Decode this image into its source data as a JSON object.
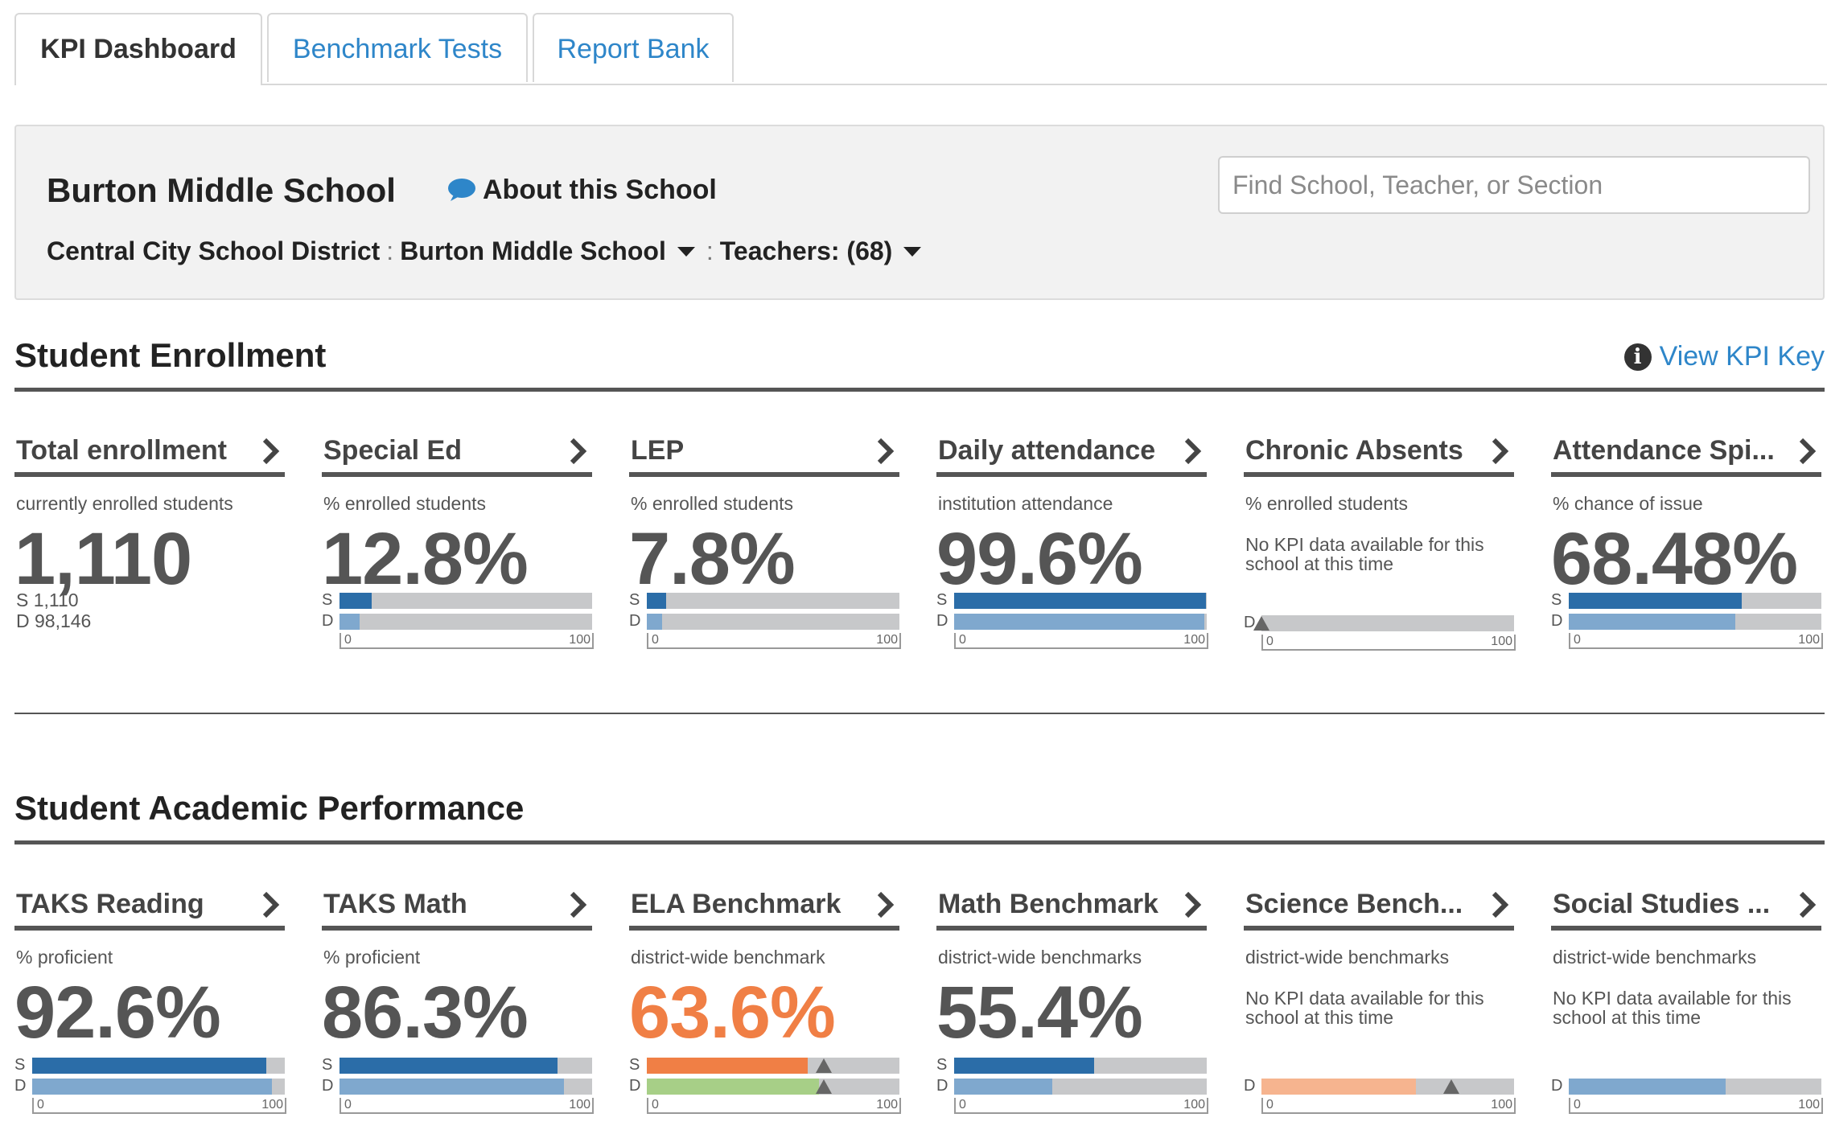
{
  "tabs": [
    "KPI Dashboard",
    "Benchmark Tests",
    "Report Bank"
  ],
  "header": {
    "school_name": "Burton Middle School",
    "about_link": "About this School",
    "breadcrumb": {
      "district": "Central City School District",
      "separator": ":",
      "school": "Burton Middle School",
      "teachers": "Teachers: (68)"
    },
    "search_placeholder": "Find School, Teacher, or Section"
  },
  "enrollment": {
    "title": "Student Enrollment",
    "kpi_key_link": "View KPI Key",
    "cards": [
      {
        "title": "Total enrollment",
        "subtitle": "currently enrolled students",
        "value": "1,110",
        "s_line": "S 1,110",
        "d_line": "D 98,146"
      },
      {
        "title": "Special Ed",
        "subtitle": "% enrolled students",
        "value": "12.8%",
        "s_pct": 12.8,
        "d_pct": 8
      },
      {
        "title": "LEP",
        "subtitle": "% enrolled students",
        "value": "7.8%",
        "s_pct": 7.8,
        "d_pct": 6
      },
      {
        "title": "Daily attendance",
        "subtitle": "institution attendance",
        "value": "99.6%",
        "s_pct": 99.6,
        "d_pct": 99
      },
      {
        "title": "Chronic Absents",
        "subtitle": "% enrolled students",
        "nodata": "No KPI data available for this school at this time"
      },
      {
        "title": "Attendance Spi...",
        "subtitle": "% chance of issue",
        "value": "68.48%",
        "s_pct": 68.5,
        "d_pct": 66
      }
    ]
  },
  "academic": {
    "title": "Student Academic Performance",
    "cards": [
      {
        "title": "TAKS Reading",
        "subtitle": "% proficient",
        "value": "92.6%",
        "s_pct": 92.6,
        "d_pct": 95
      },
      {
        "title": "TAKS Math",
        "subtitle": "% proficient",
        "value": "86.3%",
        "s_pct": 86.3,
        "d_pct": 89
      },
      {
        "title": "ELA Benchmark",
        "subtitle": "district-wide benchmark",
        "value": "63.6%",
        "s_pct": 63.6,
        "d_pct": 68,
        "target_pct": 70
      },
      {
        "title": "Math Benchmark",
        "subtitle": "district-wide benchmarks",
        "value": "55.4%",
        "s_pct": 55.4,
        "d_pct": 39
      },
      {
        "title": "Science Bench...",
        "subtitle": "district-wide benchmarks",
        "nodata": "No KPI data available for this school at this time",
        "d_pct": 61,
        "target_pct": 75
      },
      {
        "title": "Social Studies ...",
        "subtitle": "district-wide benchmarks",
        "nodata": "No KPI data available for this school at this time",
        "d_pct": 62
      }
    ]
  },
  "bars": {
    "s_label": "S",
    "d_label": "D",
    "axis_min": "0",
    "axis_max": "100"
  },
  "colors": {
    "link": "#2e86c9",
    "s_bar": "#2b6da8",
    "d_bar": "#7fa8ce",
    "track": "#c7c8ca",
    "alert_orange": "#f07f45",
    "alert_green": "#a7cf87",
    "alert_light_orange": "#f6b48f"
  }
}
